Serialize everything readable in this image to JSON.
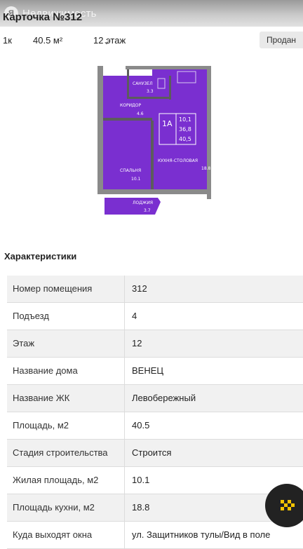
{
  "header": {
    "logo_glyph": "Я",
    "brand": "Недвижимость",
    "title": "Карточка №312"
  },
  "summary": {
    "rooms": "1к",
    "area": "40.5 м²",
    "floor": "12 этаж",
    "status_badge": "Продан"
  },
  "plan": {
    "fill_color": "#7a2fd0",
    "rooms": [
      {
        "name": "САНУЗЕЛ",
        "area": "3.3"
      },
      {
        "name": "КОРИДОР",
        "area": "4.6"
      },
      {
        "name": "СПАЛЬНЯ",
        "area": "10.1"
      },
      {
        "name": "КУХНЯ-СТОЛОВАЯ",
        "area": "18.8"
      },
      {
        "name": "ЛОДЖИЯ",
        "area": "3.7"
      }
    ],
    "type_label": "1А",
    "type_stats": [
      "10,1",
      "36,8",
      "40,5"
    ]
  },
  "characteristics": {
    "title": "Характеристики",
    "rows": [
      {
        "key": "Номер помещения",
        "value": "312"
      },
      {
        "key": "Подъезд",
        "value": "4"
      },
      {
        "key": "Этаж",
        "value": "12"
      },
      {
        "key": "Название дома",
        "value": "ВЕНЕЦ"
      },
      {
        "key": "Название ЖК",
        "value": "Левобережный"
      },
      {
        "key": "Площадь, м2",
        "value": "40.5"
      },
      {
        "key": "Стадия строительства",
        "value": "Строится"
      },
      {
        "key": "Жилая площадь, м2",
        "value": "10.1"
      },
      {
        "key": "Площадь кухни, м2",
        "value": "18.8"
      },
      {
        "key": "Куда выходят окна",
        "value": "ул. Защитников тулы/Вид в поле"
      }
    ]
  },
  "fab": {
    "icon": "taxi-checker-icon"
  }
}
